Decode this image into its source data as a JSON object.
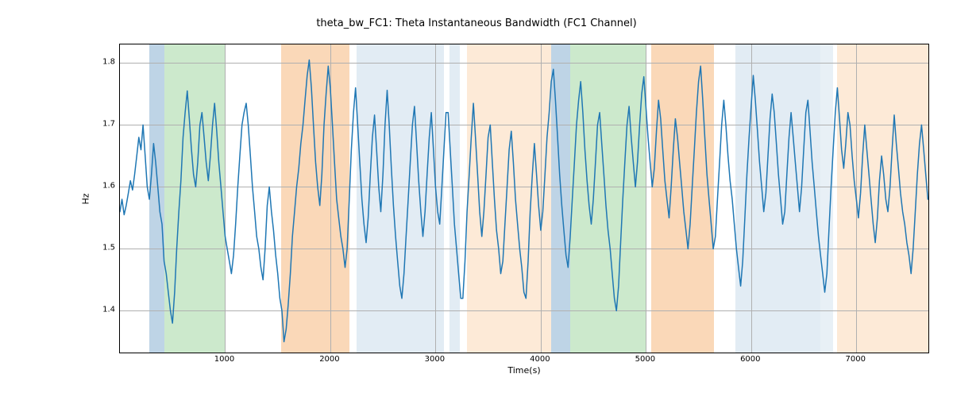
{
  "chart_data": {
    "type": "line",
    "title": "theta_bw_FC1: Theta Instantaneous Bandwidth (FC1 Channel)",
    "xlabel": "Time(s)",
    "ylabel": "Hz",
    "xlim": [
      0,
      7700
    ],
    "ylim": [
      1.33,
      1.83
    ],
    "xticks": [
      1000,
      2000,
      3000,
      4000,
      5000,
      6000,
      7000
    ],
    "yticks": [
      1.4,
      1.5,
      1.6,
      1.7,
      1.8
    ],
    "bands": [
      {
        "start": 280,
        "end": 420,
        "color": "#a8c5dd",
        "opacity": 0.75
      },
      {
        "start": 420,
        "end": 1000,
        "color": "#b7e0b7",
        "opacity": 0.7
      },
      {
        "start": 1530,
        "end": 2180,
        "color": "#f8c89a",
        "opacity": 0.7
      },
      {
        "start": 2250,
        "end": 3080,
        "color": "#d6e4ef",
        "opacity": 0.7
      },
      {
        "start": 3130,
        "end": 3230,
        "color": "#d6e4ef",
        "opacity": 0.7
      },
      {
        "start": 3300,
        "end": 4100,
        "color": "#fde5cd",
        "opacity": 0.8
      },
      {
        "start": 4100,
        "end": 4280,
        "color": "#a8c5dd",
        "opacity": 0.75
      },
      {
        "start": 4280,
        "end": 5000,
        "color": "#b7e0b7",
        "opacity": 0.7
      },
      {
        "start": 5050,
        "end": 5650,
        "color": "#f8c89a",
        "opacity": 0.7
      },
      {
        "start": 5850,
        "end": 6660,
        "color": "#d6e4ef",
        "opacity": 0.7
      },
      {
        "start": 6660,
        "end": 6780,
        "color": "#d6e4ef",
        "opacity": 0.55
      },
      {
        "start": 6820,
        "end": 7700,
        "color": "#fde5cd",
        "opacity": 0.8
      }
    ],
    "series": [
      {
        "name": "theta_bw_FC1",
        "color": "#1f77b4",
        "x_start": 0,
        "x_step": 20,
        "y": [
          1.56,
          1.58,
          1.555,
          1.57,
          1.59,
          1.61,
          1.595,
          1.62,
          1.65,
          1.68,
          1.66,
          1.7,
          1.65,
          1.6,
          1.58,
          1.62,
          1.67,
          1.64,
          1.6,
          1.56,
          1.54,
          1.48,
          1.46,
          1.43,
          1.4,
          1.38,
          1.43,
          1.5,
          1.56,
          1.61,
          1.68,
          1.72,
          1.755,
          1.71,
          1.66,
          1.62,
          1.6,
          1.64,
          1.7,
          1.72,
          1.68,
          1.64,
          1.61,
          1.65,
          1.7,
          1.735,
          1.69,
          1.64,
          1.6,
          1.56,
          1.52,
          1.5,
          1.48,
          1.46,
          1.49,
          1.54,
          1.6,
          1.65,
          1.7,
          1.72,
          1.735,
          1.7,
          1.65,
          1.6,
          1.56,
          1.52,
          1.5,
          1.47,
          1.45,
          1.5,
          1.57,
          1.6,
          1.56,
          1.53,
          1.49,
          1.46,
          1.42,
          1.4,
          1.35,
          1.37,
          1.41,
          1.46,
          1.52,
          1.56,
          1.6,
          1.63,
          1.67,
          1.7,
          1.74,
          1.78,
          1.805,
          1.76,
          1.7,
          1.64,
          1.6,
          1.57,
          1.62,
          1.7,
          1.75,
          1.795,
          1.76,
          1.7,
          1.64,
          1.58,
          1.55,
          1.52,
          1.5,
          1.47,
          1.5,
          1.58,
          1.66,
          1.72,
          1.76,
          1.7,
          1.64,
          1.58,
          1.54,
          1.51,
          1.55,
          1.62,
          1.68,
          1.716,
          1.66,
          1.6,
          1.56,
          1.62,
          1.7,
          1.756,
          1.7,
          1.63,
          1.57,
          1.52,
          1.48,
          1.44,
          1.42,
          1.46,
          1.52,
          1.58,
          1.64,
          1.7,
          1.73,
          1.67,
          1.61,
          1.56,
          1.52,
          1.56,
          1.62,
          1.68,
          1.72,
          1.66,
          1.6,
          1.56,
          1.54,
          1.6,
          1.66,
          1.72,
          1.72,
          1.66,
          1.6,
          1.54,
          1.5,
          1.46,
          1.42,
          1.42,
          1.48,
          1.56,
          1.62,
          1.68,
          1.735,
          1.68,
          1.62,
          1.56,
          1.52,
          1.56,
          1.62,
          1.68,
          1.7,
          1.64,
          1.58,
          1.53,
          1.5,
          1.46,
          1.48,
          1.54,
          1.6,
          1.66,
          1.69,
          1.64,
          1.58,
          1.54,
          1.5,
          1.47,
          1.43,
          1.42,
          1.48,
          1.56,
          1.62,
          1.67,
          1.62,
          1.57,
          1.53,
          1.56,
          1.62,
          1.68,
          1.72,
          1.77,
          1.79,
          1.74,
          1.68,
          1.62,
          1.57,
          1.53,
          1.49,
          1.47,
          1.52,
          1.58,
          1.64,
          1.7,
          1.74,
          1.77,
          1.72,
          1.66,
          1.61,
          1.57,
          1.54,
          1.58,
          1.64,
          1.7,
          1.72,
          1.67,
          1.62,
          1.57,
          1.53,
          1.5,
          1.46,
          1.42,
          1.4,
          1.44,
          1.51,
          1.58,
          1.64,
          1.7,
          1.73,
          1.68,
          1.64,
          1.6,
          1.64,
          1.7,
          1.75,
          1.778,
          1.73,
          1.68,
          1.64,
          1.6,
          1.63,
          1.69,
          1.74,
          1.71,
          1.66,
          1.61,
          1.58,
          1.55,
          1.6,
          1.66,
          1.71,
          1.68,
          1.64,
          1.6,
          1.56,
          1.53,
          1.5,
          1.54,
          1.6,
          1.66,
          1.72,
          1.77,
          1.795,
          1.74,
          1.68,
          1.62,
          1.58,
          1.54,
          1.5,
          1.52,
          1.58,
          1.64,
          1.7,
          1.74,
          1.7,
          1.65,
          1.61,
          1.58,
          1.54,
          1.5,
          1.47,
          1.44,
          1.48,
          1.55,
          1.62,
          1.68,
          1.73,
          1.78,
          1.74,
          1.69,
          1.64,
          1.6,
          1.56,
          1.59,
          1.65,
          1.71,
          1.75,
          1.72,
          1.67,
          1.62,
          1.58,
          1.54,
          1.56,
          1.62,
          1.68,
          1.72,
          1.68,
          1.64,
          1.6,
          1.56,
          1.6,
          1.66,
          1.72,
          1.74,
          1.69,
          1.64,
          1.6,
          1.56,
          1.52,
          1.49,
          1.46,
          1.43,
          1.46,
          1.53,
          1.6,
          1.66,
          1.72,
          1.76,
          1.71,
          1.66,
          1.63,
          1.67,
          1.72,
          1.7,
          1.65,
          1.61,
          1.58,
          1.55,
          1.59,
          1.65,
          1.7,
          1.66,
          1.62,
          1.58,
          1.54,
          1.51,
          1.55,
          1.61,
          1.65,
          1.62,
          1.58,
          1.56,
          1.6,
          1.66,
          1.716,
          1.67,
          1.63,
          1.59,
          1.56,
          1.54,
          1.51,
          1.49,
          1.46,
          1.5,
          1.56,
          1.62,
          1.67,
          1.7,
          1.66,
          1.62,
          1.58
        ]
      }
    ]
  }
}
